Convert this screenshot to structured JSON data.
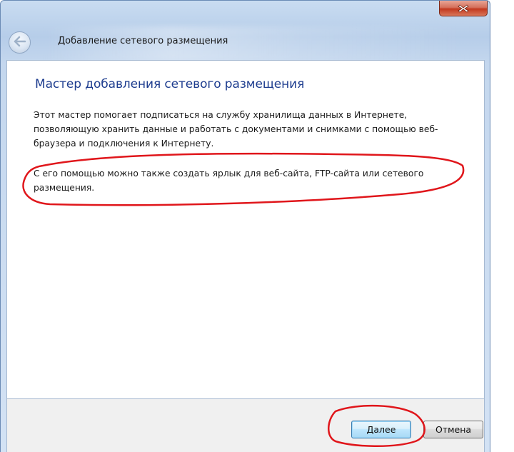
{
  "window": {
    "title": "Добавление сетевого размещения"
  },
  "heading": "Мастер добавления сетевого размещения",
  "paragraphs": {
    "intro": "Этот мастер помогает подписаться на службу хранилища данных в Интернете, позволяющую хранить данные и работать с документами и снимками с помощью веб-браузера и подключения к Интернету.",
    "extra": "С его помощью можно также создать ярлык для веб-сайта, FTP-сайта или сетевого размещения."
  },
  "buttons": {
    "next": "Далее",
    "cancel": "Отмена"
  },
  "icons": {
    "close": "close-icon",
    "back": "back-arrow-icon"
  },
  "colors": {
    "heading": "#1e3d8f",
    "annotation": "#e0161b",
    "close_button": "#c2391f"
  }
}
